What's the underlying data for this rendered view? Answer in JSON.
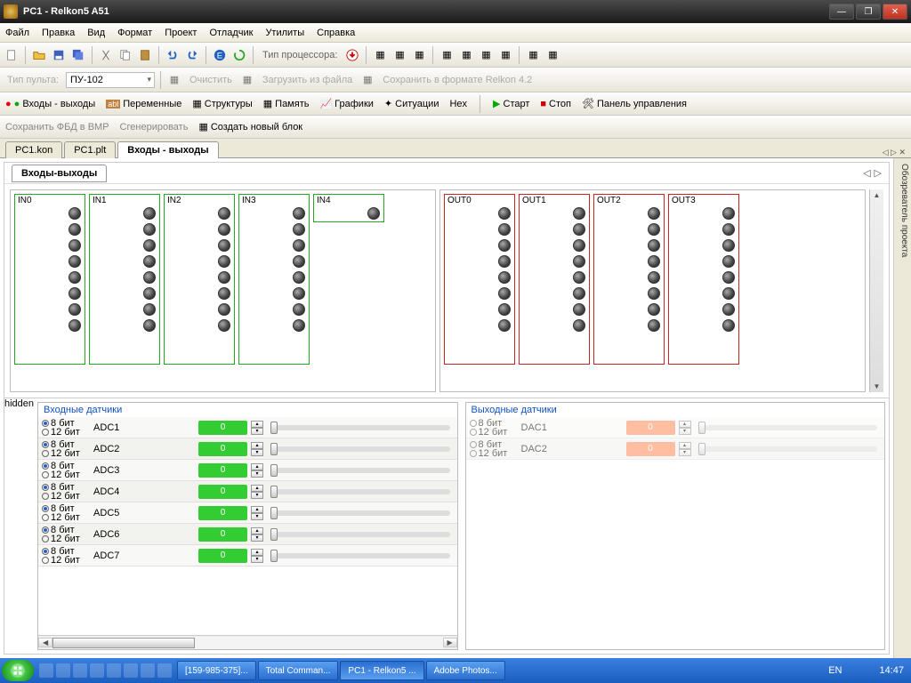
{
  "window": {
    "title": "PC1 - Relkon5 A51"
  },
  "menu": [
    "Файл",
    "Правка",
    "Вид",
    "Формат",
    "Проект",
    "Отладчик",
    "Утилиты",
    "Справка"
  ],
  "toolbar2": {
    "cpu_label": "Тип процессора:",
    "console_label": "Тип пульта:",
    "console_value": "ПУ-102",
    "clear": "Очистить",
    "load": "Загрузить из файла",
    "save": "Сохранить в формате Relkon 4.2"
  },
  "viewbar": {
    "io": "Входы - выходы",
    "vars": "Переменные",
    "structs": "Структуры",
    "mem": "Память",
    "charts": "Графики",
    "sit": "Ситуации",
    "hex": "Hex",
    "start": "Старт",
    "stop": "Стоп",
    "cp": "Панель управления"
  },
  "row2": {
    "savebmp": "Сохранить ФБД в BMP",
    "gen": "Сгенерировать",
    "newblock": "Создать новый блок"
  },
  "tabs": {
    "t1": "PC1.kon",
    "t2": "PC1.plt",
    "t3": "Входы - выходы"
  },
  "subtab": "Входы-выходы",
  "sidepanel": "Обозреватель проекта",
  "inputs": [
    "IN0",
    "IN1",
    "IN2",
    "IN3",
    "IN4"
  ],
  "outputs": [
    "OUT0",
    "OUT1",
    "OUT2",
    "OUT3"
  ],
  "in_panel": {
    "title": "Входные датчики",
    "bit8": "8 бит",
    "bit12": "12 бит",
    "items": [
      "ADC1",
      "ADC2",
      "ADC3",
      "ADC4",
      "ADC5",
      "ADC6",
      "ADC7"
    ],
    "value": "0"
  },
  "out_panel": {
    "title": "Выходные датчики",
    "bit8": "8 бит",
    "bit12": "12 бит",
    "items": [
      "DAC1",
      "DAC2"
    ],
    "value": "0"
  },
  "taskbar": {
    "items": [
      "[159-985-375]...",
      "Total Comman...",
      "PC1 - Relkon5 ...",
      "Adobe Photos..."
    ],
    "lang": "EN",
    "time": "14:47"
  }
}
